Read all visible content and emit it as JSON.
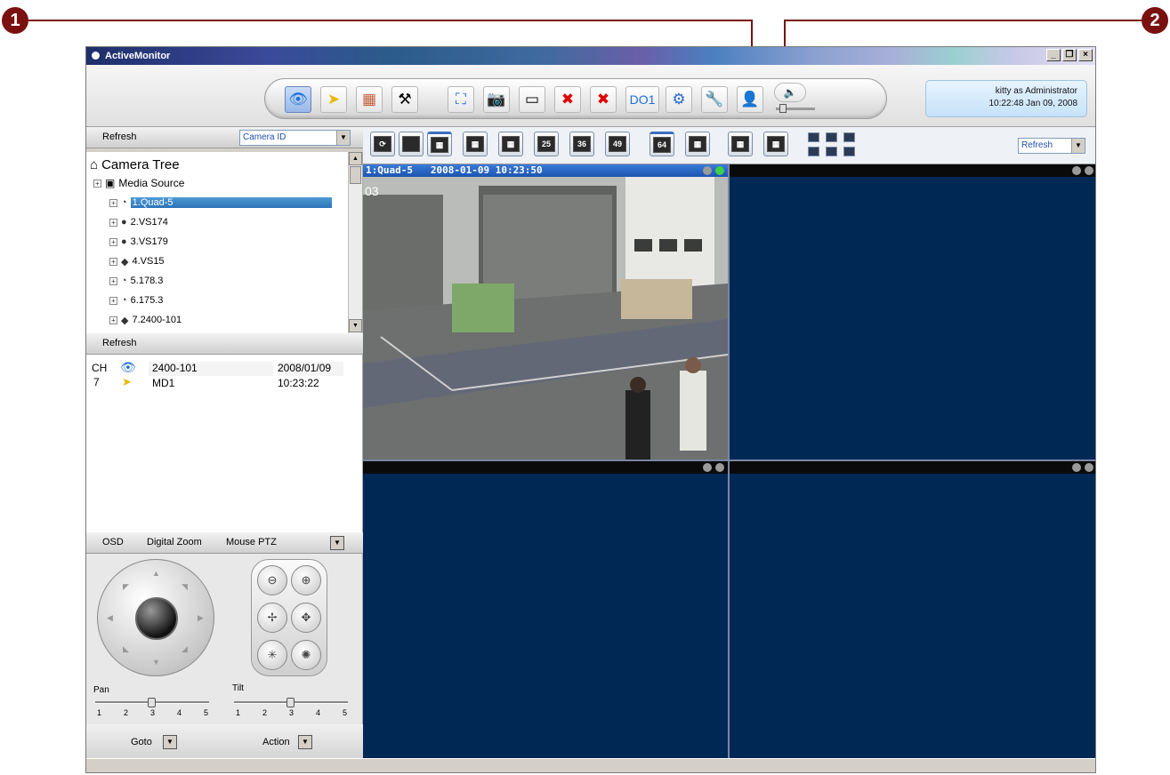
{
  "callouts": {
    "one": "1",
    "two": "2"
  },
  "window": {
    "title": "ActiveMonitor"
  },
  "user": {
    "line1": "kitty as Administrator",
    "line2": "10:22:48 Jan 09, 2008"
  },
  "left_panel": {
    "refresh_label": "Refresh",
    "sort_combo_value": "Camera ID",
    "tree": {
      "root": "Camera Tree",
      "source": "Media Source",
      "items": [
        {
          "label": "1.Quad-5",
          "selected": true
        },
        {
          "label": "2.VS174"
        },
        {
          "label": "3.VS179"
        },
        {
          "label": "4.VS15"
        },
        {
          "label": "5.178.3"
        },
        {
          "label": "6.175.3"
        },
        {
          "label": "7.2400-101"
        }
      ]
    },
    "event_refresh_label": "Refresh",
    "events": {
      "ch_label": "CH",
      "ch_value": "7",
      "device": "2400-101",
      "event": "MD1",
      "date": "2008/01/09",
      "time": "10:23:22"
    }
  },
  "ptz": {
    "tabs": [
      "OSD",
      "Digital Zoom",
      "Mouse PTZ"
    ],
    "pan_label": "Pan",
    "tilt_label": "Tilt",
    "ticks": [
      "1",
      "2",
      "3",
      "4",
      "5"
    ],
    "pan_value": 3,
    "tilt_value": 3,
    "goto_label": "Goto",
    "action_label": "Action"
  },
  "video": {
    "layout_labels": [
      "25",
      "36",
      "49",
      "64"
    ],
    "refresh_combo": "Refresh",
    "pane1_title": "1:Quad-5   2008-01-09 10:23:50",
    "overlay_text": "03"
  },
  "toolbar": {
    "tools": [
      "live-view",
      "event-log",
      "map",
      "settings-tools",
      "full-screen",
      "snapshot",
      "record",
      "stop-all",
      "stop-camera",
      "digital-output",
      "configuration",
      "user-1",
      "user-2",
      "audio"
    ],
    "do_label": "DO1"
  },
  "colors": {
    "pane_bg": "#002855",
    "accent": "#3a7ad8",
    "callout": "#7a1010"
  }
}
